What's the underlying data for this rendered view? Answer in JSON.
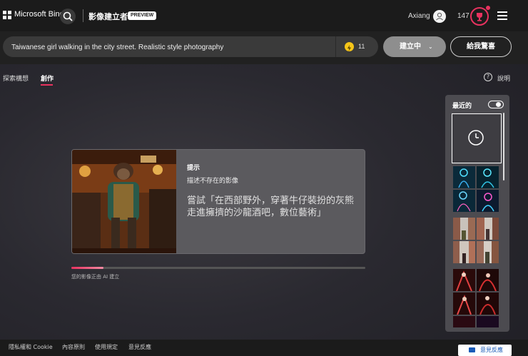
{
  "header": {
    "brand": "Microsoft Bing",
    "title": "影像建立者",
    "badge": "PREVIEW",
    "user_name": "Axiang",
    "points": "147"
  },
  "prompt_bar": {
    "value": "Taiwanese girl walking in the city street. Realistic style photography",
    "boost_count": "11",
    "create_label": "建立中",
    "surprise_label": "給我驚喜"
  },
  "tabs": [
    {
      "label": "探索構想",
      "active": false
    },
    {
      "label": "創作",
      "active": true
    }
  ],
  "help_label": "說明",
  "tip": {
    "heading": "提示",
    "subheading": "描述不存在的影像",
    "body": "嘗試「在西部野外，穿著牛仔裝扮的灰熊走進擁擠的沙龍酒吧，數位藝術」"
  },
  "progress": {
    "fraction": 0.11,
    "label": "您的影像正由 AI 建立"
  },
  "recent": {
    "title": "最近的",
    "toggle_on": true
  },
  "footer": {
    "links": [
      "隱私權和 Cookie",
      "內容原則",
      "使用規定",
      "意見反應"
    ],
    "feedback_button": "意見反應"
  },
  "colors": {
    "accent": "#e8325f",
    "header_bg": "#1b1b1b",
    "boost": "#f5c518"
  }
}
